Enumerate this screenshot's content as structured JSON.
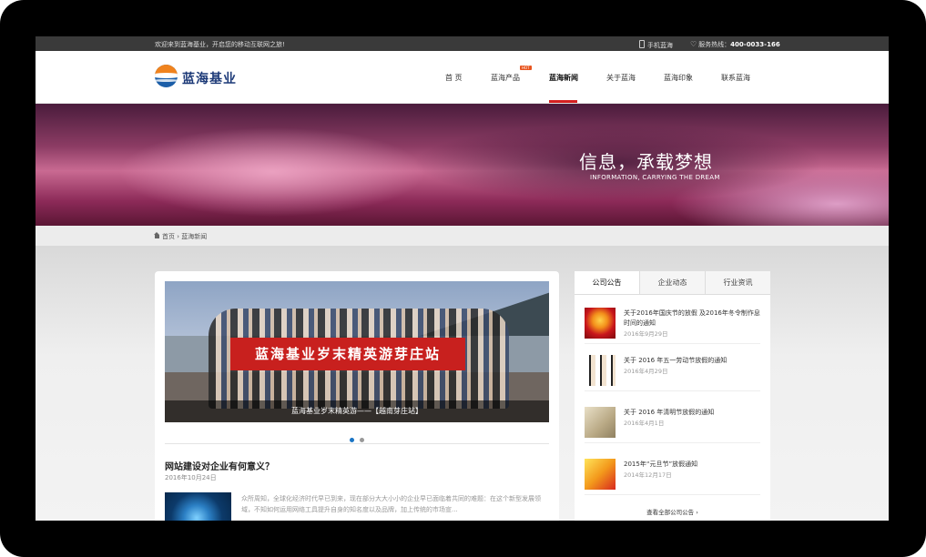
{
  "topbar": {
    "welcome": "欢迎来到蓝海基业，开启您的移动互联网之旅!",
    "mobile": "手机蓝海",
    "hotline_label": "服务热线：",
    "hotline_number": "400-0033-166"
  },
  "header": {
    "logo_text": "蓝海基业",
    "nav": [
      "首 页",
      "蓝海产品",
      "蓝海新闻",
      "关于蓝海",
      "蓝海印象",
      "联系蓝海"
    ],
    "hot_badge": "HOT",
    "active_nav": "蓝海新闻",
    "accent_color": "#d42020"
  },
  "banner": {
    "title": "信息，承载梦想",
    "subtitle": "INFORMATION, CARRYING THE DREAM"
  },
  "breadcrumb": {
    "home": "首页",
    "separator": "›",
    "current": "蓝海新闻"
  },
  "slider": {
    "banner_text": "蓝海基业岁末精英游芽庄站",
    "caption": "蓝海基业岁末精英游——【越南芽庄站】",
    "dots": 2,
    "active_dot": 0
  },
  "post": {
    "title": "网站建设对企业有何意义？",
    "date": "2016年10月24日",
    "excerpt": "众所周知，全球化经济时代早已到来，现在部分大大小小的企业早已面临着共同的难题：在这个新型发展领域，不知如何运用网络工具提升自身的知名度以及品牌，加上传统的市场宣..."
  },
  "sidebar": {
    "tabs": [
      "公司公告",
      "企业动态",
      "行业资讯"
    ],
    "active_tab": "公司公告",
    "notices": [
      {
        "title": "关于2016年国庆节的放假 及2016年冬令制作息时间的通知",
        "date": "2016年9月29日"
      },
      {
        "title": "关于 2016 年五一劳动节放假的通知",
        "date": "2016年4月29日"
      },
      {
        "title": "关于 2016 年清明节放假的通知",
        "date": "2016年4月1日"
      },
      {
        "title": "2015年“元旦节”放假通知",
        "date": "2014年12月17日"
      }
    ],
    "more": "查看全部公司公告 ›"
  }
}
